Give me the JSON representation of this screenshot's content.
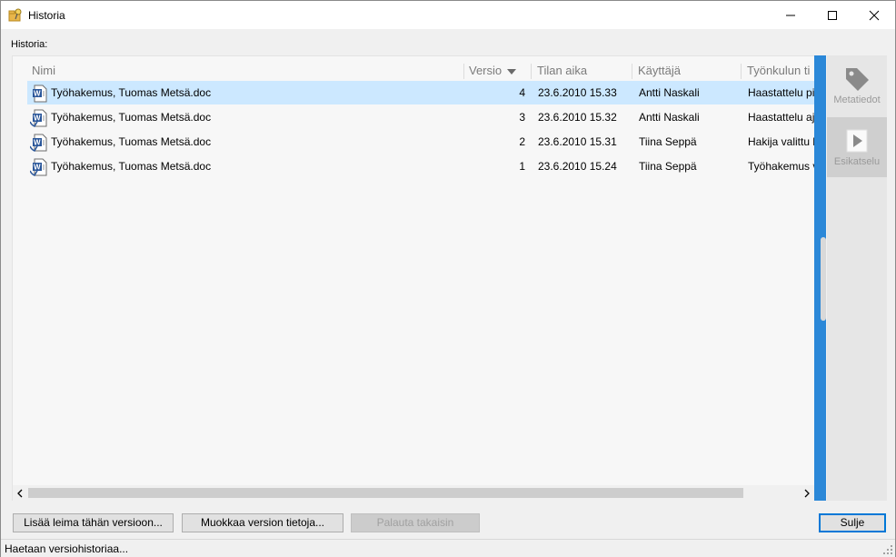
{
  "window": {
    "title": "Historia",
    "app_icon": "folder-key-icon",
    "controls": {
      "minimize": "minimize-icon",
      "maximize": "maximize-icon",
      "close": "close-icon"
    }
  },
  "section_label": "Historia:",
  "table": {
    "columns": [
      {
        "label": "Nimi"
      },
      {
        "label": "Versio",
        "sorted": "desc"
      },
      {
        "label": "Tilan aika"
      },
      {
        "label": "Käyttäjä"
      },
      {
        "label": "Työnkulun ti"
      }
    ],
    "rows": [
      {
        "name": "Työhakemus, Tuomas Metsä.doc",
        "version": "4",
        "time": "23.6.2010 15.33",
        "user": "Antti Naskali",
        "workflow": "Haastattelu pi",
        "selected": true,
        "icon": "word-document-icon"
      },
      {
        "name": "Työhakemus, Tuomas Metsä.doc",
        "version": "3",
        "time": "23.6.2010 15.32",
        "user": "Antti Naskali",
        "workflow": "Haastattelu aj",
        "selected": false,
        "icon": "word-document-checked-icon"
      },
      {
        "name": "Työhakemus, Tuomas Metsä.doc",
        "version": "2",
        "time": "23.6.2010 15.31",
        "user": "Tiina Seppä",
        "workflow": "Hakija valittu l",
        "selected": false,
        "icon": "word-document-checked-icon"
      },
      {
        "name": "Työhakemus, Tuomas Metsä.doc",
        "version": "1",
        "time": "23.6.2010 15.24",
        "user": "Tiina Seppä",
        "workflow": "Työhakemus v",
        "selected": false,
        "icon": "word-document-checked-icon"
      }
    ]
  },
  "side_panel": {
    "tabs": [
      {
        "label": "Metatiedot",
        "icon": "tag-icon",
        "active": false
      },
      {
        "label": "Esikatselu",
        "icon": "play-icon",
        "active": true
      }
    ]
  },
  "buttons": {
    "add_label": "Lisää leima tähän versioon...",
    "edit_version": "Muokkaa version tietoja...",
    "restore": "Palauta takaisin",
    "close": "Sulje"
  },
  "status": "Haetaan versiohistoriaa...",
  "colors": {
    "accent": "#2b88d8",
    "selection": "#cce8ff",
    "default_button_border": "#0078d7"
  }
}
